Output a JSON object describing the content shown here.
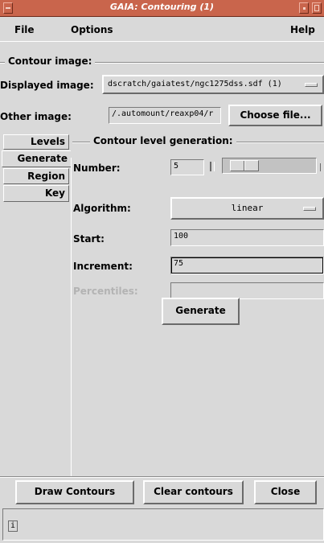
{
  "window": {
    "title": "GAIA: Contouring (1)"
  },
  "menubar": {
    "file": "File",
    "options": "Options",
    "help": "Help"
  },
  "contour_image": {
    "legend": "Contour image:",
    "displayed_label": "Displayed image:",
    "displayed_value": "dscratch/gaiatest/ngc1275dss.sdf (1)",
    "other_label": "Other image:",
    "other_value": "/.automount/reaxp04/r",
    "choose_button": "Choose file..."
  },
  "tabs": [
    {
      "label": "Levels",
      "active": false
    },
    {
      "label": "Generate",
      "active": true
    },
    {
      "label": "Region",
      "active": false
    },
    {
      "label": "Key",
      "active": false
    }
  ],
  "generation": {
    "legend": "Contour level generation:",
    "number_label": "Number:",
    "number_value": "5",
    "number_fraction": 0.1,
    "algorithm_label": "Algorithm:",
    "algorithm_value": "linear",
    "start_label": "Start:",
    "start_value": "100",
    "increment_label": "Increment:",
    "increment_value": "75",
    "percentiles_label": "Percentiles:",
    "percentiles_value": "",
    "generate_button": "Generate"
  },
  "footer": {
    "draw_button": "Draw Contours",
    "clear_button": "Clear contours",
    "close_button": "Close",
    "status_icon_glyph": "i",
    "status_text": ""
  },
  "colors": {
    "titlebar": "#c9654c",
    "background": "#d9d9d9"
  }
}
